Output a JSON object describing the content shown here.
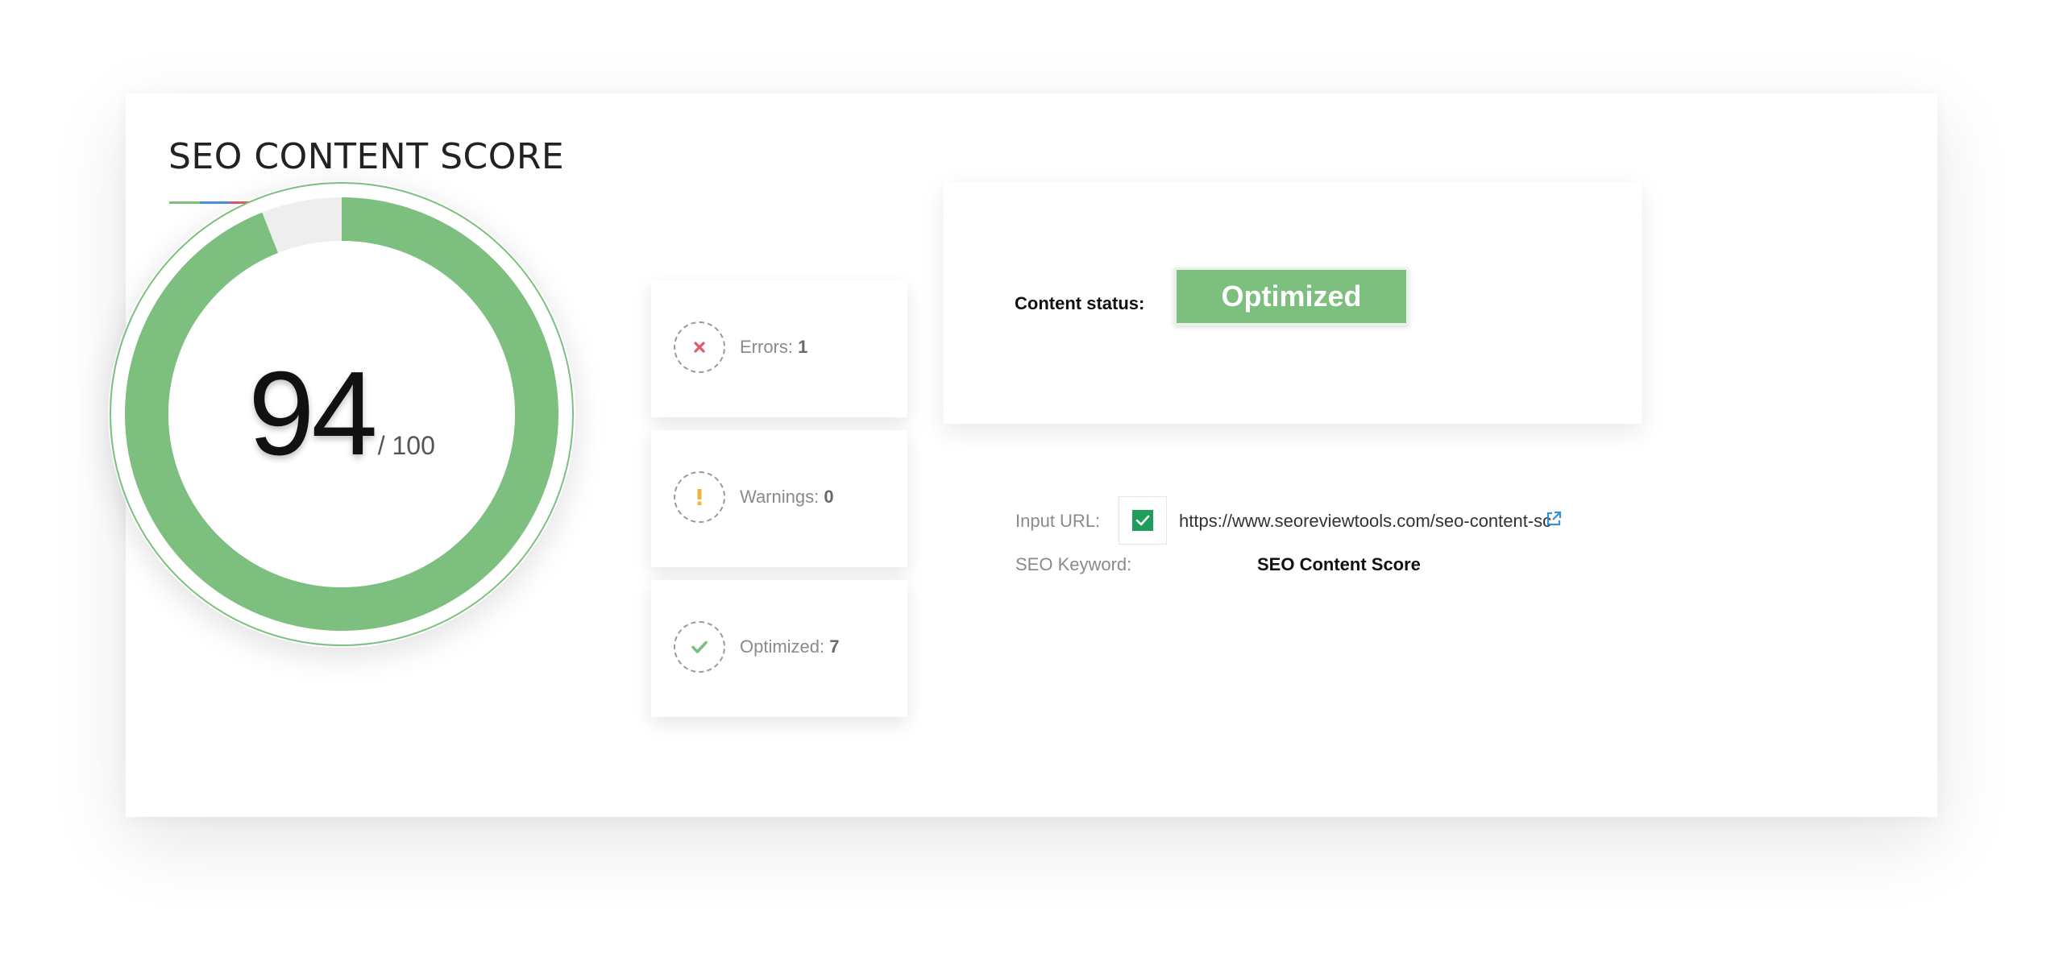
{
  "header": {
    "title": "SEO CONTENT SCORE",
    "underline_colors": [
      "#7cbf7e",
      "#4a90d9",
      "#e05a6a",
      "#f2b33d"
    ]
  },
  "score": {
    "value": "94",
    "max_label": "/ 100",
    "fraction": 0.94,
    "ring_color": "#7cbf7e",
    "track_color": "#eeeeee"
  },
  "stats": [
    {
      "icon": "x-icon",
      "label": "Errors:",
      "count": "1",
      "color": "#e05a6a"
    },
    {
      "icon": "exclamation-icon",
      "label": "Warnings:",
      "count": "0",
      "color": "#f2b33d"
    },
    {
      "icon": "check-icon",
      "label": "Optimized:",
      "count": "7",
      "color": "#7cbf7e"
    }
  ],
  "status": {
    "label": "Content status:",
    "value": "Optimized",
    "color": "#7cbf7e"
  },
  "info": {
    "url_label": "Input URL:",
    "url": "https://www.seoreviewtools.com/seo-content-sc",
    "keyword_label": "SEO Keyword:",
    "keyword": "SEO Content Score",
    "link_color": "#3a8fd0"
  }
}
